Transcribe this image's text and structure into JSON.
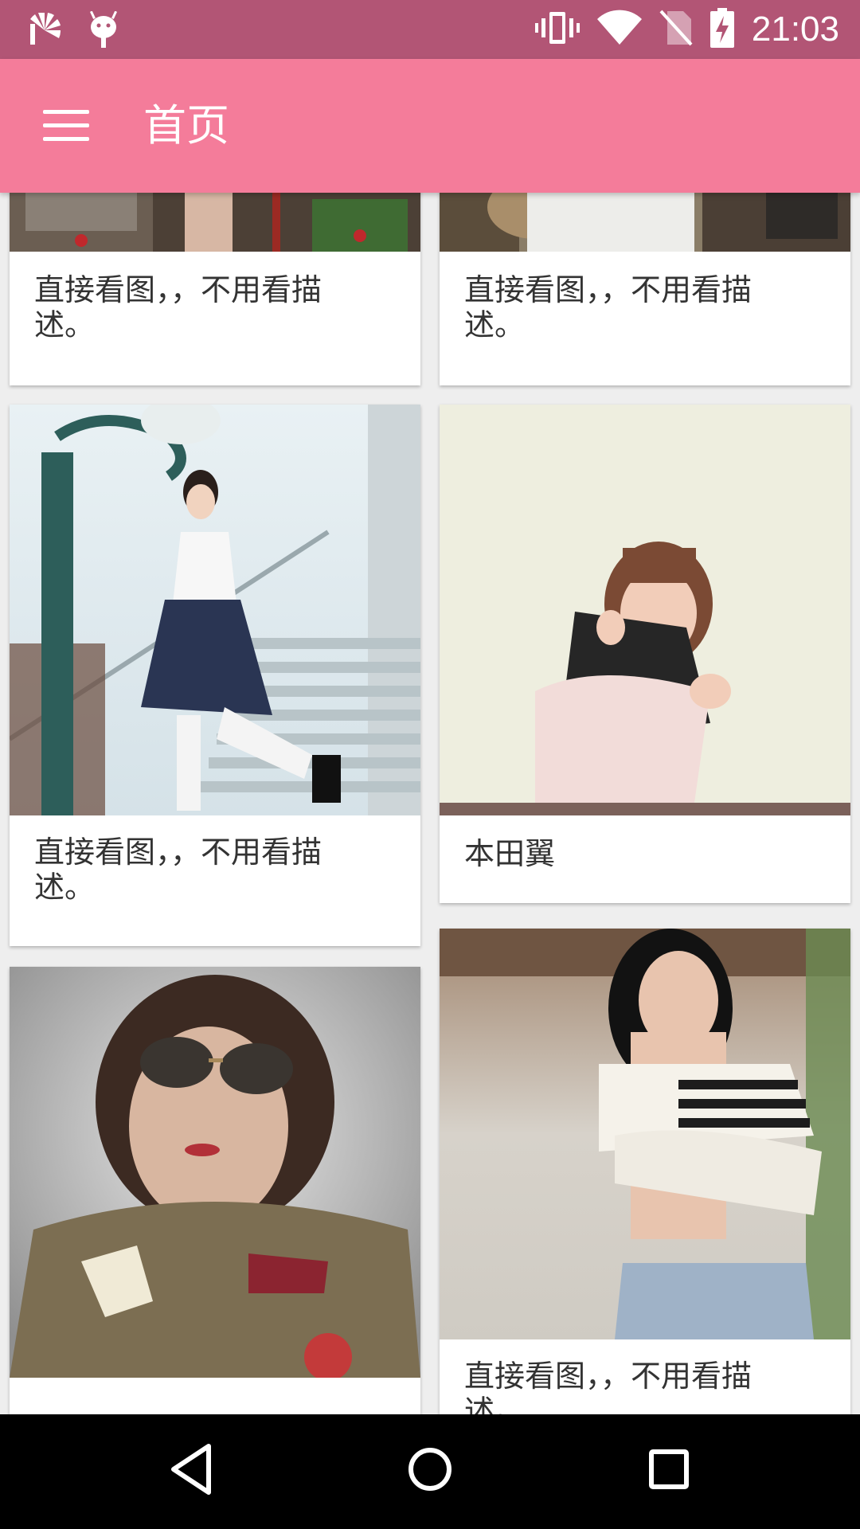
{
  "status_bar": {
    "time": "21:03",
    "icons": [
      "app-notification-icon",
      "android-debug-icon",
      "vibrate-icon",
      "wifi-icon",
      "no-sim-icon",
      "battery-charging-icon"
    ]
  },
  "app_bar": {
    "menu_icon": "menu-icon",
    "title": "首页"
  },
  "cards": [
    {
      "description": "直接看图，，不用看描述。",
      "image": "storefront-photo"
    },
    {
      "description": "直接看图，，不用看描述。",
      "image": "white-dress-photo"
    },
    {
      "description": "直接看图，，不用看描述。",
      "image": "stairs-school-uniform-photo"
    },
    {
      "description": "本田翼",
      "image": "sitting-girl-photo"
    },
    {
      "description": "",
      "image": "aviator-sunglasses-photo"
    },
    {
      "description": "直接看图，，不用看描述。",
      "image": "striped-top-photo"
    }
  ],
  "nav_bar": {
    "buttons": [
      "back-icon",
      "home-icon",
      "recents-icon"
    ]
  },
  "colors": {
    "status_bar": "#b25575",
    "app_bar": "#f47c9a",
    "background": "#eeeeee",
    "nav_bar": "#000000"
  }
}
